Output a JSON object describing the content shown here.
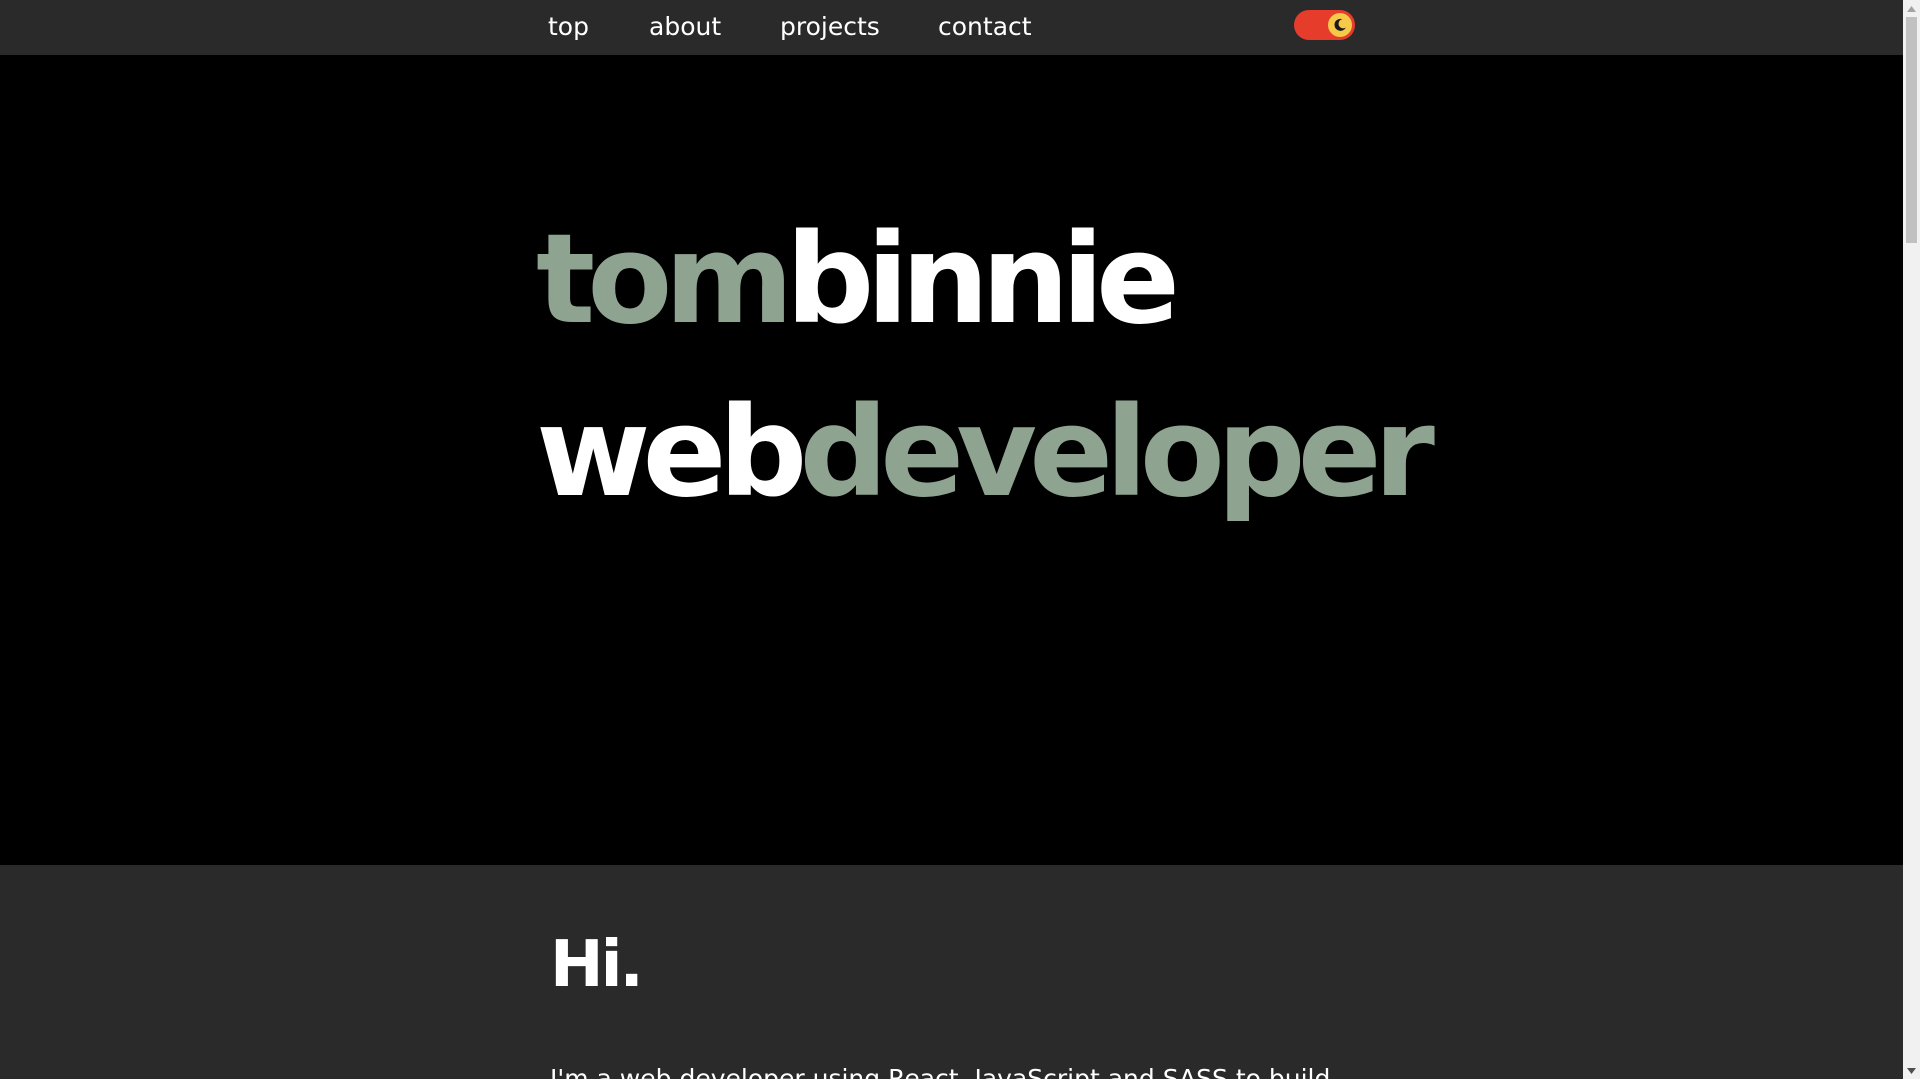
{
  "nav": {
    "links": [
      "top",
      "about",
      "projects",
      "contact"
    ]
  },
  "theme_toggle": {
    "state": "dark",
    "track_color": "#e63c2c",
    "knob_color": "#f7c948",
    "icon": "moon-icon"
  },
  "hero": {
    "line1": {
      "part1": "tom",
      "part2": "binnie"
    },
    "line2": {
      "part1": "web",
      "part2": "developer"
    },
    "accent_color": "#8fa391",
    "text_color": "#ffffff",
    "background": "#000000"
  },
  "about": {
    "heading": "Hi.",
    "intro": "I'm a web developer using React, JavaScript and SASS to build"
  },
  "colors": {
    "navbar_bg": "#2a2a2a",
    "section_bg": "#2a2a2a"
  }
}
